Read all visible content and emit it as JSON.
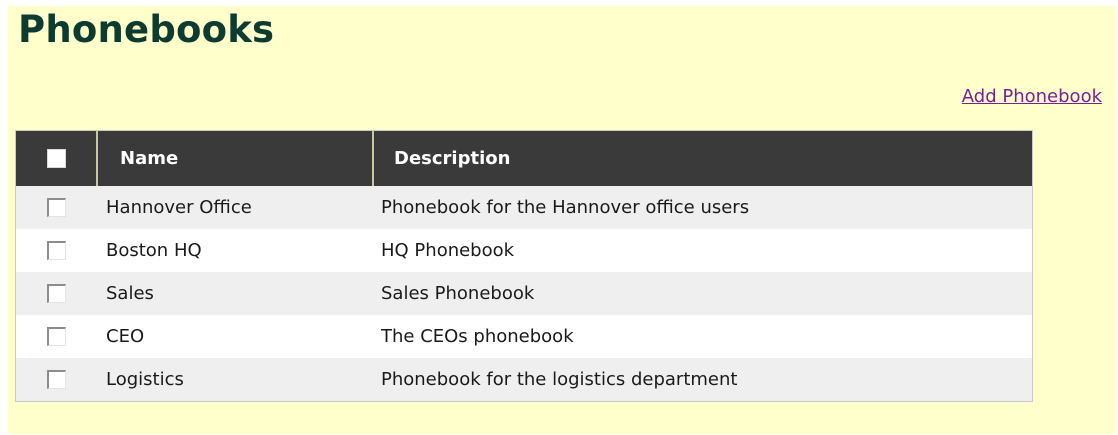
{
  "page": {
    "title": "Phonebooks",
    "add_link": "Add Phonebook"
  },
  "table": {
    "columns": [
      "",
      "Name",
      "Description"
    ],
    "rows": [
      {
        "name": "Hannover Office",
        "description": "Phonebook for the Hannover office users",
        "checked": false
      },
      {
        "name": "Boston HQ",
        "description": "HQ Phonebook",
        "checked": false
      },
      {
        "name": "Sales",
        "description": "Sales Phonebook",
        "checked": false
      },
      {
        "name": "CEO",
        "description": "The CEOs phonebook",
        "checked": false
      },
      {
        "name": "Logistics",
        "description": "Phonebook for the logistics department",
        "checked": false
      }
    ]
  },
  "colors": {
    "panel_background": "#ffffcc",
    "title": "#0e3b30",
    "link": "#7a1f9a",
    "header_background": "#3a3a3a",
    "row_alternate": "#efefef"
  }
}
